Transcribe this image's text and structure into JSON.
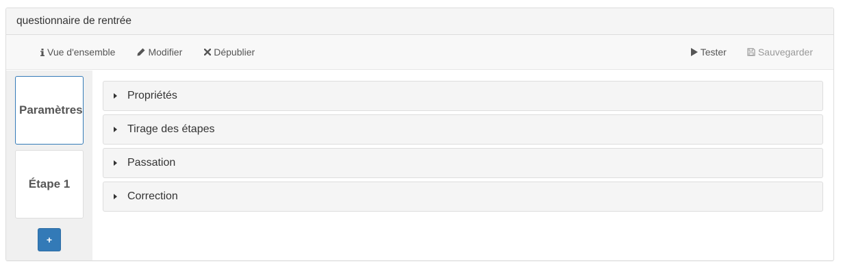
{
  "panel": {
    "title": "questionnaire de rentrée"
  },
  "toolbar": {
    "left": [
      {
        "label": "Vue d'ensemble",
        "icon": "info-icon"
      },
      {
        "label": "Modifier",
        "icon": "pencil-icon"
      },
      {
        "label": "Dépublier",
        "icon": "close-icon"
      }
    ],
    "right": [
      {
        "label": "Tester",
        "icon": "play-icon"
      },
      {
        "label": "Sauvegarder",
        "icon": "floppy-disk-icon",
        "disabled": true
      }
    ]
  },
  "sidebar": {
    "steps": [
      {
        "label": "Paramètres",
        "active": true
      },
      {
        "label": "Étape 1",
        "active": false
      }
    ],
    "add_label": "+"
  },
  "sections": [
    {
      "label": "Propriétés"
    },
    {
      "label": "Tirage des étapes"
    },
    {
      "label": "Passation"
    },
    {
      "label": "Correction"
    }
  ],
  "colors": {
    "primary": "#337ab7",
    "border": "#dddddd",
    "section_bg": "#f5f5f5",
    "sidebar_bg": "#f0f0f0"
  }
}
